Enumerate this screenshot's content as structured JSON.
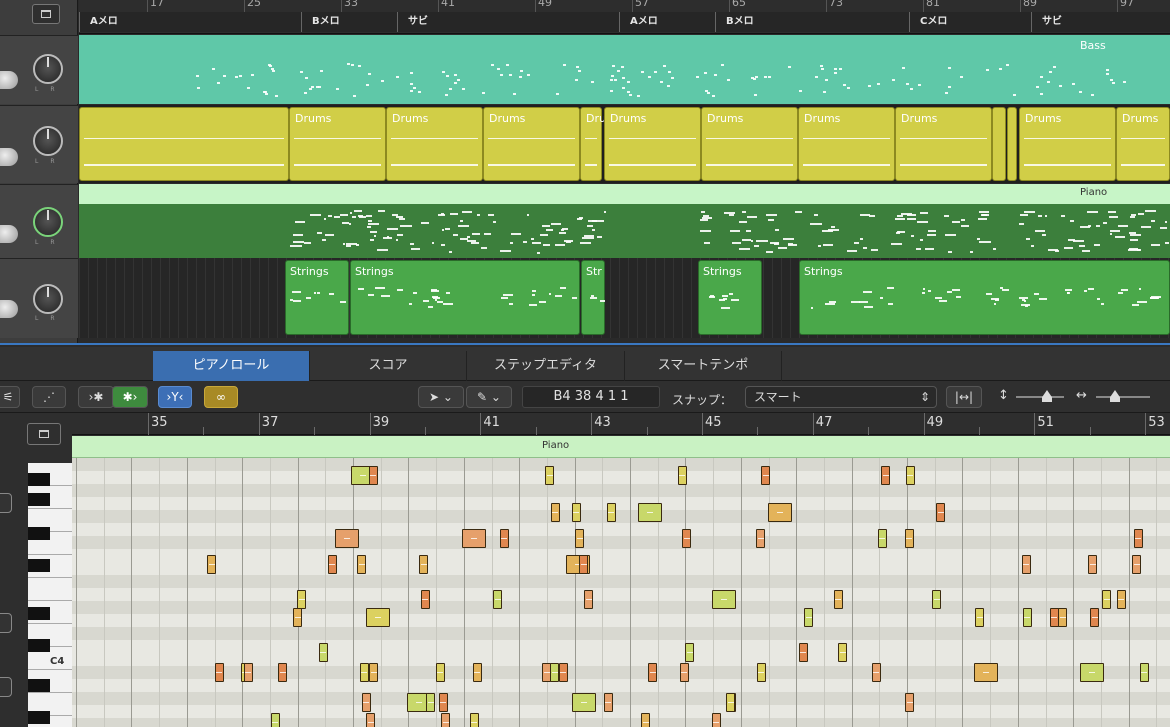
{
  "top_ruler": {
    "bar_numbers": [
      "17",
      "25",
      "33",
      "41",
      "49",
      "57",
      "65",
      "73",
      "81",
      "89",
      "97"
    ],
    "markers": [
      "Aメロ",
      "Bメロ",
      "サビ",
      "Aメロ",
      "Bメロ",
      "Cメロ",
      "サビ"
    ]
  },
  "tracks": {
    "bass_label": "Bass",
    "drums_label": "Drums",
    "drums_short_label": "Dr",
    "piano_label": "Piano",
    "strings_label": "Strings",
    "strings_short_label": "Str"
  },
  "editor": {
    "tabs": [
      "ピアノロール",
      "スコア",
      "ステップエディタ",
      "スマートテンポ"
    ],
    "active_tab": "ピアノロール",
    "position_display": "B4   38 4 1 1",
    "snap_label": "スナップ：",
    "snap_value": "スマート",
    "bar_numbers": [
      "35",
      "37",
      "39",
      "41",
      "43",
      "45",
      "47",
      "49",
      "51",
      "53"
    ],
    "region_name": "Piano",
    "c4_label": "C4"
  },
  "colors": {
    "bass": "#5fc8a8",
    "drums": "#d1ce47",
    "piano_region": "#3c7f3c",
    "strings": "#4aa84a",
    "active_tab": "#3a6eb0"
  }
}
